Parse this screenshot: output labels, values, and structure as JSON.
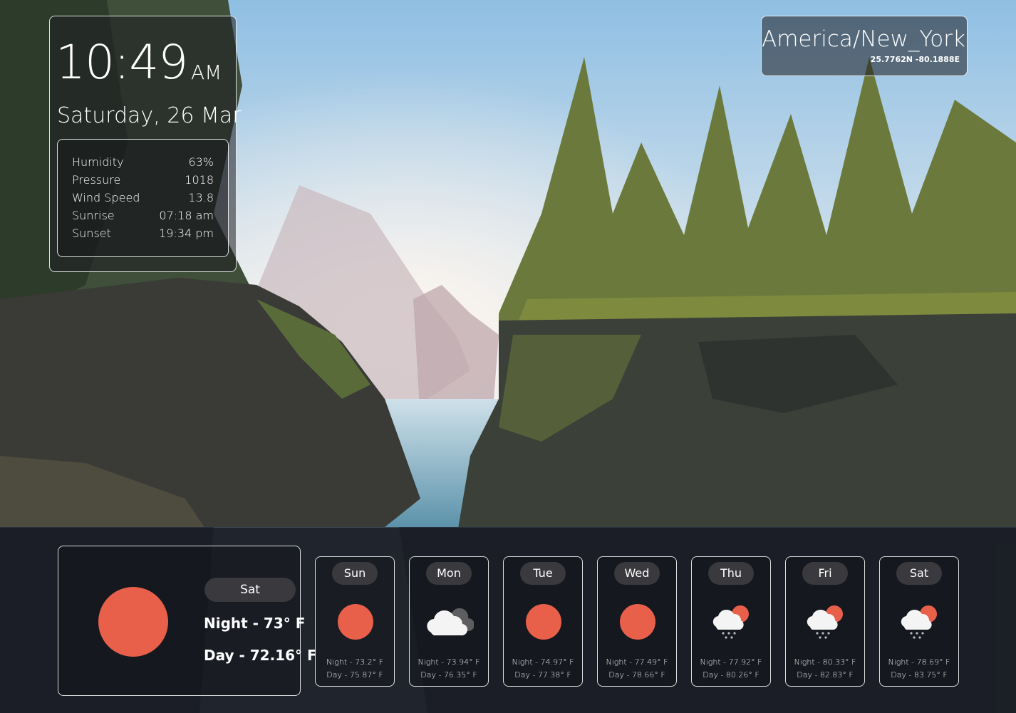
{
  "clock": {
    "time": "10:49",
    "ampm": "AM",
    "date": "Saturday, 26 Mar"
  },
  "details": [
    {
      "label": "Humidity",
      "value": "63%"
    },
    {
      "label": "Pressure",
      "value": "1018"
    },
    {
      "label": "Wind Speed",
      "value": "13.8"
    },
    {
      "label": "Sunrise",
      "value": "07:18 am"
    },
    {
      "label": "Sunset",
      "value": "19:34 pm"
    }
  ],
  "timezone": {
    "name": "America/New_York",
    "coords": "25.7762N -80.1888E"
  },
  "today": {
    "day": "Sat",
    "night": "Night - 73° F",
    "day_temp": "Day - 72.16° F",
    "icon": "sun-icon"
  },
  "forecast": [
    {
      "day": "Sun",
      "icon": "sun-icon",
      "night": "Night - 73.2° F",
      "day_temp": "Day - 75.87° F"
    },
    {
      "day": "Mon",
      "icon": "cloud-icon",
      "night": "Night - 73.94° F",
      "day_temp": "Day - 76.35° F"
    },
    {
      "day": "Tue",
      "icon": "sun-icon",
      "night": "Night - 74.97° F",
      "day_temp": "Day - 77.38° F"
    },
    {
      "day": "Wed",
      "icon": "sun-icon",
      "night": "Night - 77.49° F",
      "day_temp": "Day - 78.66° F"
    },
    {
      "day": "Thu",
      "icon": "rain-cloud-sun-icon",
      "night": "Night - 77.92° F",
      "day_temp": "Day - 80.26° F"
    },
    {
      "day": "Fri",
      "icon": "rain-cloud-sun-icon",
      "night": "Night - 80.33° F",
      "day_temp": "Day - 82.83° F"
    },
    {
      "day": "Sat",
      "icon": "rain-cloud-sun-icon",
      "night": "Night - 78.69° F",
      "day_temp": "Day - 83.75° F"
    }
  ],
  "colors": {
    "sun": "#e8604a",
    "pill": "#3a3a3e"
  }
}
